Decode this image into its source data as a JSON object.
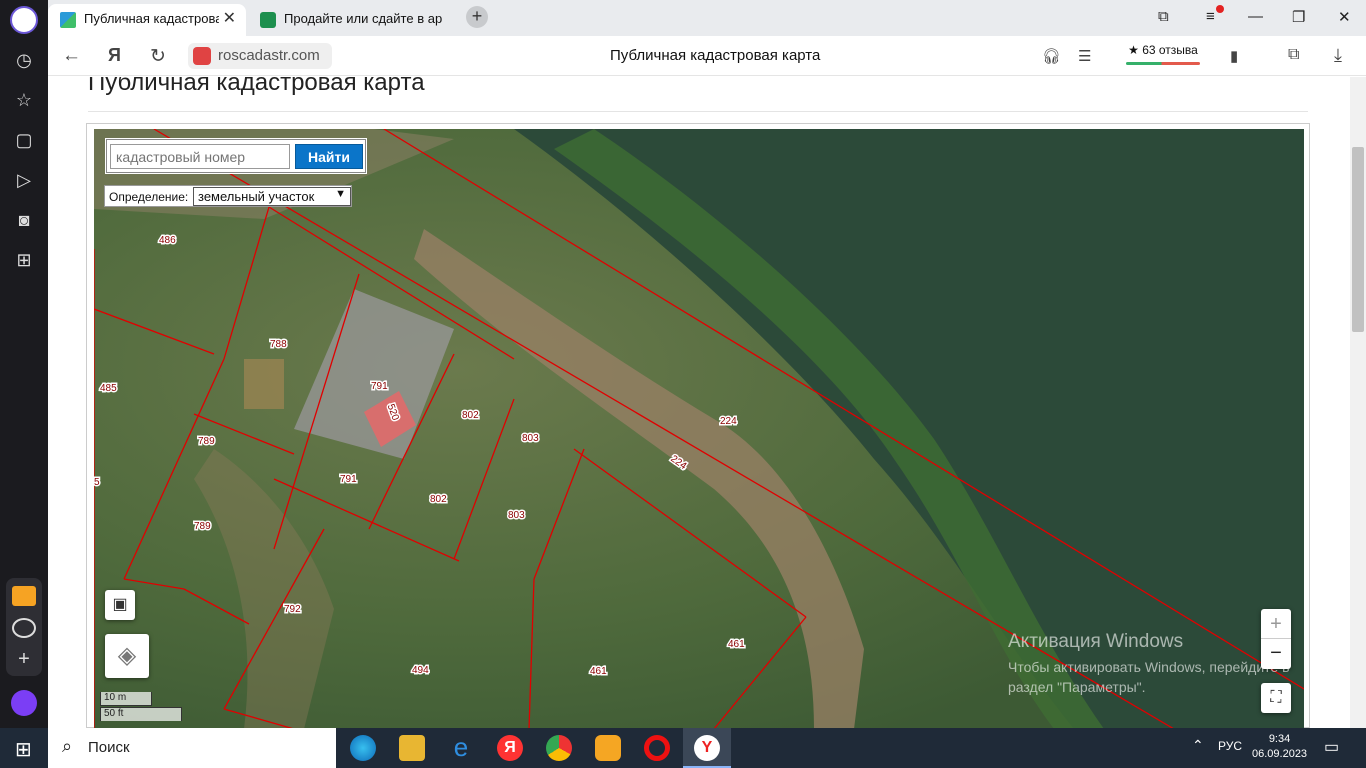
{
  "browser": {
    "tabs": [
      {
        "label": "Публичная кадастрова",
        "active": true
      },
      {
        "label": "Продайте или сдайте в ар",
        "active": false
      }
    ],
    "url": "roscadastr.com",
    "page_title": "Публичная кадастровая карта",
    "reviews": "★ 63 отзыва"
  },
  "page": {
    "heading": "Публичная кадастровая карта"
  },
  "map": {
    "search_placeholder": "кадастровый номер",
    "search_button": "Найти",
    "definition_label": "Определение:",
    "definition_value": "земельный участок",
    "scale_m": "10 m",
    "scale_ft": "50 ft",
    "zoom_in": "+",
    "zoom_out": "−",
    "parcel_labels": [
      "486",
      "788",
      "485",
      "791",
      "520",
      "802",
      "803",
      "224",
      "224",
      "789",
      "791",
      "802",
      "803",
      "789",
      "792",
      "494",
      "461",
      "461",
      "5"
    ]
  },
  "watermark": {
    "title": "Активация Windows",
    "line1": "Чтобы активировать Windows, перейдите в",
    "line2": "раздел \"Параметры\"."
  },
  "taskbar": {
    "search": "Поиск",
    "lang": "РУС",
    "time": "9:34",
    "date": "06.09.2023"
  }
}
